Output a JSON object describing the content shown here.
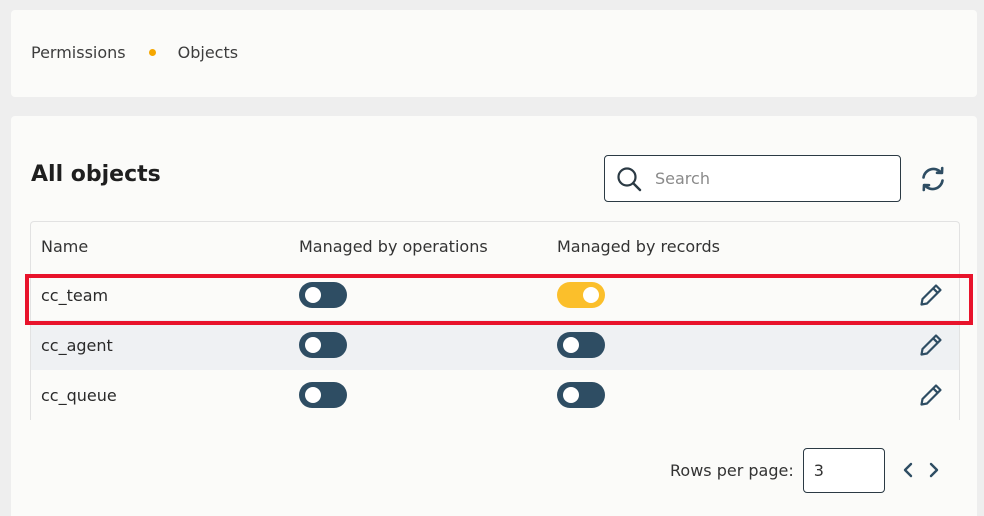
{
  "breadcrumb": {
    "items": [
      "Permissions",
      "Objects"
    ]
  },
  "main": {
    "title": "All objects",
    "search": {
      "placeholder": "Search",
      "value": ""
    }
  },
  "table": {
    "columns": [
      "Name",
      "Managed by operations",
      "Managed by records"
    ],
    "rows": [
      {
        "name": "cc_team",
        "operations_on": false,
        "records_on": true,
        "highlighted": true
      },
      {
        "name": "cc_agent",
        "operations_on": false,
        "records_on": false
      },
      {
        "name": "cc_queue",
        "operations_on": false,
        "records_on": false
      }
    ]
  },
  "pagination": {
    "rows_per_page_label": "Rows per page:",
    "rows_per_page_value": "3"
  },
  "colors": {
    "toggle_off": "#2e4d63",
    "toggle_on": "#fbbf2b",
    "breadcrumb_dot": "#f5a700",
    "highlight": "#e8132b"
  },
  "icons": {
    "search": "search-icon",
    "refresh": "refresh-icon",
    "edit": "pencil-icon",
    "prev": "chevron-left-icon",
    "next": "chevron-right-icon"
  }
}
